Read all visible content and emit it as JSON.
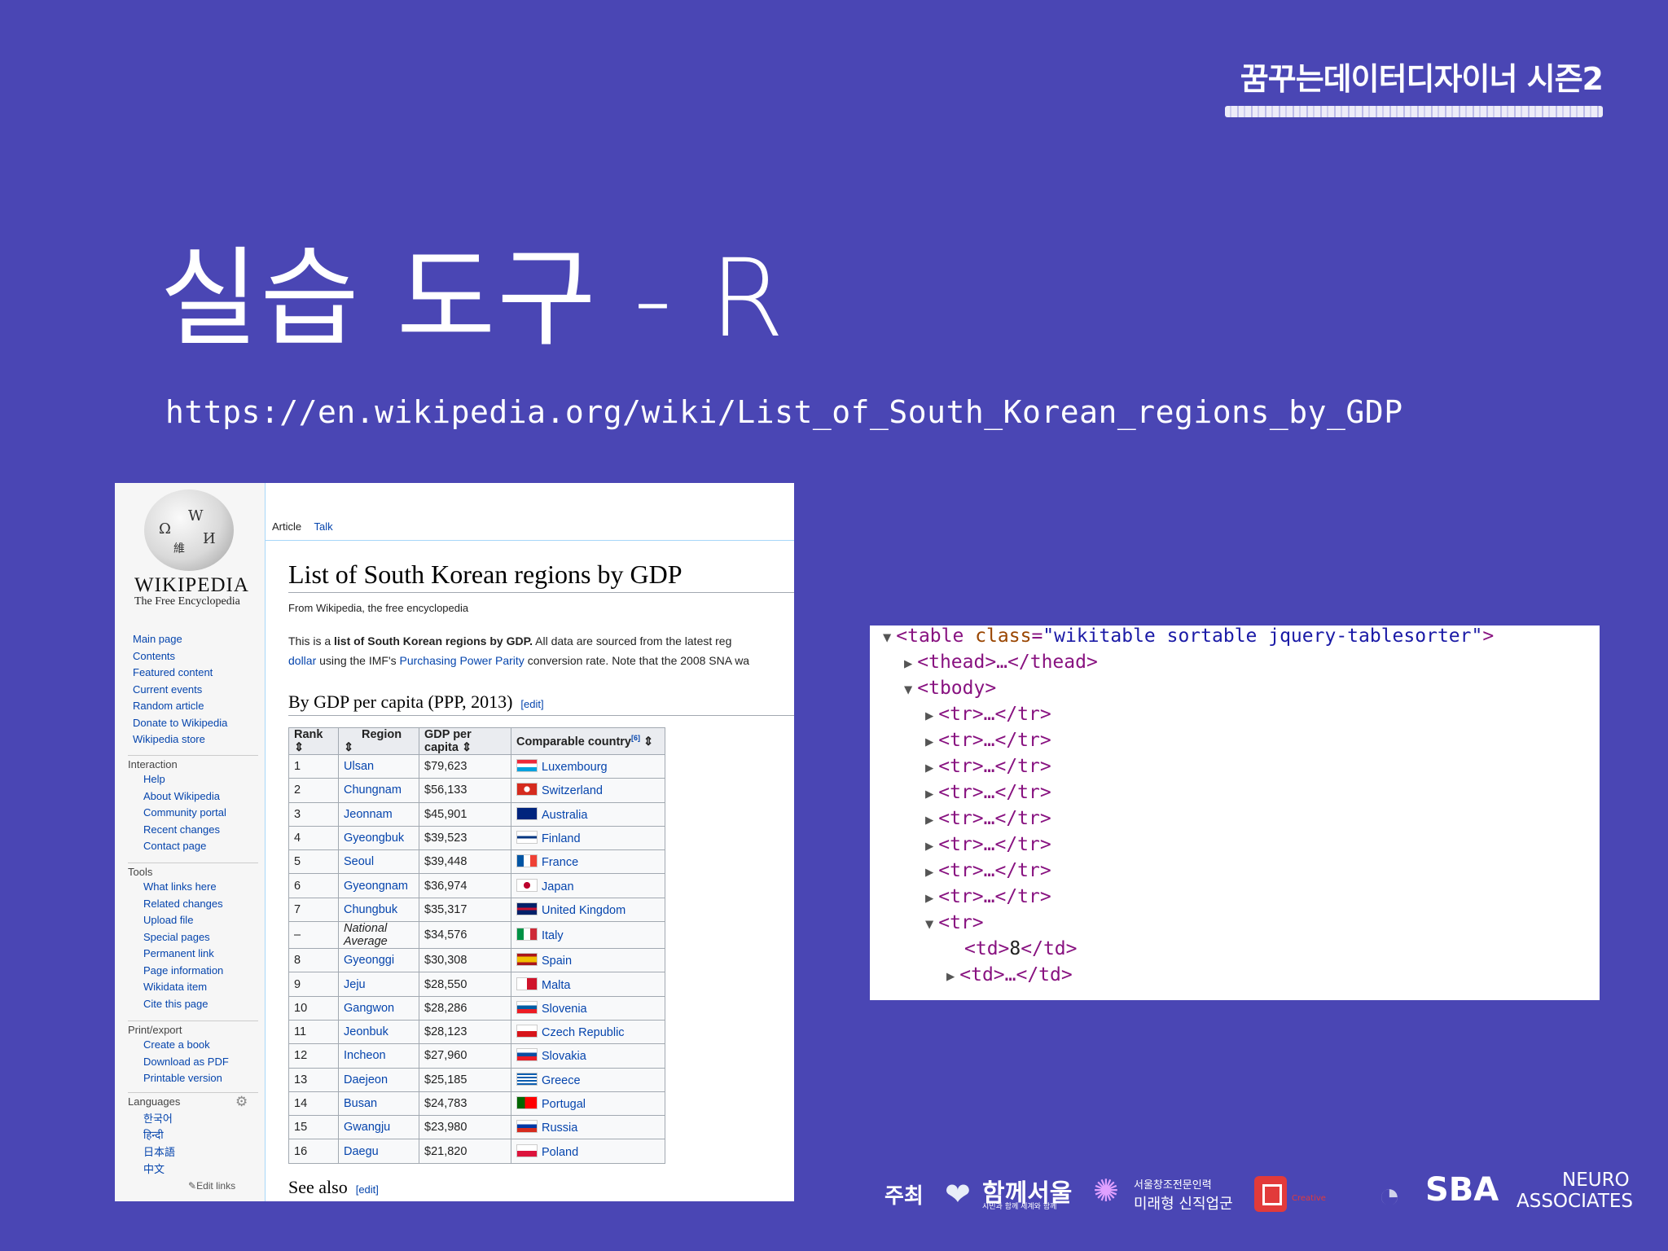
{
  "slide": {
    "brand": "꿈꾸는데이터디자이너 시즌2",
    "title": "실습 도구 - R",
    "url": "https://en.wikipedia.org/wiki/List_of_South_Korean_regions_by_GDP"
  },
  "wiki": {
    "logo_word": "WIKIPEDIA",
    "logo_tagline": "The Free Encyclopedia",
    "nav_main": [
      "Main page",
      "Contents",
      "Featured content",
      "Current events",
      "Random article",
      "Donate to Wikipedia",
      "Wikipedia store"
    ],
    "interaction_head": "Interaction",
    "interaction": [
      "Help",
      "About Wikipedia",
      "Community portal",
      "Recent changes",
      "Contact page"
    ],
    "tools_head": "Tools",
    "tools": [
      "What links here",
      "Related changes",
      "Upload file",
      "Special pages",
      "Permanent link",
      "Page information",
      "Wikidata item",
      "Cite this page"
    ],
    "print_head": "Print/export",
    "print": [
      "Create a book",
      "Download as PDF",
      "Printable version"
    ],
    "languages_head": "Languages",
    "languages": [
      "한국어",
      "हिन्दी",
      "日本語",
      "中文"
    ],
    "edit_links": "Edit links",
    "tab_article": "Article",
    "tab_talk": "Talk",
    "page_title": "List of South Korean regions by GDP",
    "from": "From Wikipedia, the free encyclopedia",
    "intro_1a": "This is a ",
    "intro_1b": "list of South Korean regions by GDP.",
    "intro_1c": " All data are sourced from the latest reg",
    "intro_2a": "dollar",
    "intro_2b": " using the IMF's ",
    "intro_2c": "Purchasing Power Parity",
    "intro_2d": " conversion rate. Note that the 2008 SNA wa",
    "section_title": "By GDP per capita (PPP, 2013)",
    "edit": "[edit]",
    "see_also": "See also",
    "table_headers": [
      "Rank",
      "Region",
      "GDP per capita",
      "Comparable country"
    ],
    "ref_mark": "[6]",
    "rows": [
      {
        "rank": "1",
        "region": "Ulsan",
        "gdp": "$79,623",
        "country": "Luxembourg",
        "flag": "lu"
      },
      {
        "rank": "2",
        "region": "Chungnam",
        "gdp": "$56,133",
        "country": "Switzerland",
        "flag": "ch"
      },
      {
        "rank": "3",
        "region": "Jeonnam",
        "gdp": "$45,901",
        "country": "Australia",
        "flag": "au"
      },
      {
        "rank": "4",
        "region": "Gyeongbuk",
        "gdp": "$39,523",
        "country": "Finland",
        "flag": "fi"
      },
      {
        "rank": "5",
        "region": "Seoul",
        "gdp": "$39,448",
        "country": "France",
        "flag": "fr"
      },
      {
        "rank": "6",
        "region": "Gyeongnam",
        "gdp": "$36,974",
        "country": "Japan",
        "flag": "jp"
      },
      {
        "rank": "7",
        "region": "Chungbuk",
        "gdp": "$35,317",
        "country": "United Kingdom",
        "flag": "gb"
      },
      {
        "rank": "–",
        "region": "National Average",
        "gdp": "$34,576",
        "country": "Italy",
        "flag": "it",
        "italic": true
      },
      {
        "rank": "8",
        "region": "Gyeonggi",
        "gdp": "$30,308",
        "country": "Spain",
        "flag": "es"
      },
      {
        "rank": "9",
        "region": "Jeju",
        "gdp": "$28,550",
        "country": "Malta",
        "flag": "mt"
      },
      {
        "rank": "10",
        "region": "Gangwon",
        "gdp": "$28,286",
        "country": "Slovenia",
        "flag": "si"
      },
      {
        "rank": "11",
        "region": "Jeonbuk",
        "gdp": "$28,123",
        "country": "Czech Republic",
        "flag": "cz"
      },
      {
        "rank": "12",
        "region": "Incheon",
        "gdp": "$27,960",
        "country": "Slovakia",
        "flag": "sk"
      },
      {
        "rank": "13",
        "region": "Daejeon",
        "gdp": "$25,185",
        "country": "Greece",
        "flag": "gr"
      },
      {
        "rank": "14",
        "region": "Busan",
        "gdp": "$24,783",
        "country": "Portugal",
        "flag": "pt"
      },
      {
        "rank": "15",
        "region": "Gwangju",
        "gdp": "$23,980",
        "country": "Russia",
        "flag": "ru"
      },
      {
        "rank": "16",
        "region": "Daegu",
        "gdp": "$21,820",
        "country": "Poland",
        "flag": "pl"
      }
    ]
  },
  "devtools": {
    "table_open_a": "<table ",
    "table_attr": "class",
    "table_eq": "=",
    "table_val": "\"wikitable sortable jquery-tablesorter\"",
    "table_open_b": ">",
    "thead": "<thead>…</thead>",
    "tbody": "<tbody>",
    "tr_collapsed": "<tr>…</tr>",
    "tr_open": "<tr>",
    "td_open": "<td>",
    "td_value": "8",
    "td_close": "</td>",
    "td_collapsed": "<td>…</td>"
  },
  "footer": {
    "host": "주최",
    "sponsor1": "함께서울",
    "sponsor1_sub": "시민과 함께 세계와 함께",
    "sponsor2_a": "서울창조전문인력",
    "sponsor2_b": "미래형 신직업군",
    "sponsor3": "Creative",
    "sponsor4": "SBA",
    "sponsor5_a": "NEURO",
    "sponsor5_b": "ASSOCIATES"
  },
  "colors": {
    "background": "#4a46b4",
    "link": "#0645ad",
    "tag": "#881280",
    "attr": "#994500",
    "value": "#1a1aa6"
  }
}
